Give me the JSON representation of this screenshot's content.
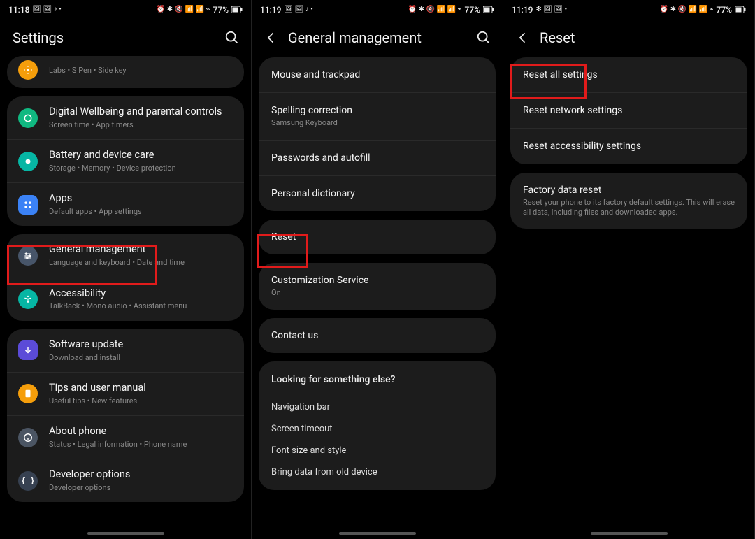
{
  "status": {
    "s1": {
      "time": "11:18",
      "battery": "77%",
      "left_glyphs": "🖼 🖼 ♪ •",
      "right_glyphs": "⏰ ✱ 🔇 📶 📶 ⌁"
    },
    "s2": {
      "time": "11:19",
      "battery": "77%",
      "left_glyphs": "🖼 🖼 ♪ •",
      "right_glyphs": "⏰ ✱ 🔇 📶 📶 ⌁"
    },
    "s3": {
      "time": "11:19",
      "battery": "77%",
      "left_glyphs": "✻ 🖼 🖼 •",
      "right_glyphs": "⏰ ✱ 🔇 📶 📶 ⌁"
    }
  },
  "screen1": {
    "header_title": "Settings",
    "items": [
      {
        "title": "",
        "sub": "Labs  •  S Pen  •  Side key"
      },
      {
        "title": "Digital Wellbeing and parental controls",
        "sub": "Screen time  •  App timers"
      },
      {
        "title": "Battery and device care",
        "sub": "Storage  •  Memory  •  Device protection"
      },
      {
        "title": "Apps",
        "sub": "Default apps  •  App settings"
      },
      {
        "title": "General management",
        "sub": "Language and keyboard  •  Date and time"
      },
      {
        "title": "Accessibility",
        "sub": "TalkBack  •  Mono audio  •  Assistant menu"
      },
      {
        "title": "Software update",
        "sub": "Download and install"
      },
      {
        "title": "Tips and user manual",
        "sub": "Useful tips  •  New features"
      },
      {
        "title": "About phone",
        "sub": "Status  •  Legal information  •  Phone name"
      },
      {
        "title": "Developer options",
        "sub": "Developer options"
      }
    ]
  },
  "screen2": {
    "header_title": "General management",
    "group1": [
      {
        "title": "Mouse and trackpad",
        "sub": ""
      },
      {
        "title": "Spelling correction",
        "sub": "Samsung Keyboard"
      },
      {
        "title": "Passwords and autofill",
        "sub": ""
      },
      {
        "title": "Personal dictionary",
        "sub": ""
      }
    ],
    "reset_label": "Reset",
    "customization": {
      "title": "Customization Service",
      "sub": "On"
    },
    "contact_label": "Contact us",
    "looking": {
      "title": "Looking for something else?",
      "items": [
        "Navigation bar",
        "Screen timeout",
        "Font size and style",
        "Bring data from old device"
      ]
    }
  },
  "screen3": {
    "header_title": "Reset",
    "group1": [
      "Reset all settings",
      "Reset network settings",
      "Reset accessibility settings"
    ],
    "factory": {
      "title": "Factory data reset",
      "sub": "Reset your phone to its factory default settings. This will erase all data, including files and downloaded apps."
    }
  }
}
